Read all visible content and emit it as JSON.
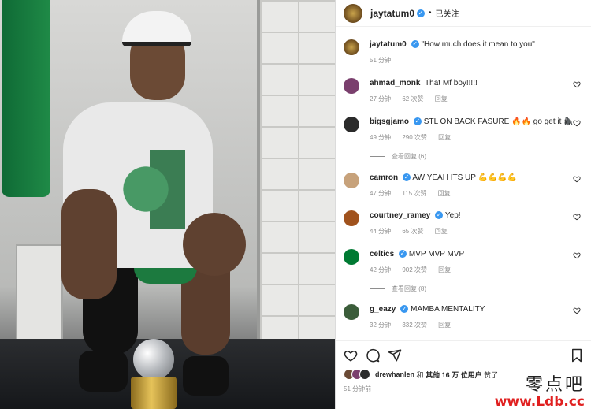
{
  "post": {
    "username": "jaytatum0",
    "follow_status": "已关注",
    "separator": "•",
    "avatar_color": "#8a6a1d"
  },
  "caption": {
    "username": "jaytatum0",
    "text": "\"How much does it mean to you\"",
    "time": "51 分钟"
  },
  "comments": [
    {
      "username": "ahmad_monk",
      "verified": false,
      "text": "That Mf boy!!!!!",
      "time": "27 分钟",
      "likes": "62 次赞",
      "reply": "回复",
      "avatar_color": "#7a3f6d"
    },
    {
      "username": "bigsgjamo",
      "verified": true,
      "text": "STL ON BACK FASURE 🔥🔥 go get it 🦍",
      "time": "49 分钟",
      "likes": "290 次赞",
      "reply": "回复",
      "view_replies": "查看回复 (6)",
      "avatar_color": "#2b2b2b"
    },
    {
      "username": "camron",
      "verified": true,
      "text": "AW YEAH ITS UP 💪💪💪💪",
      "time": "47 分钟",
      "likes": "115 次赞",
      "reply": "回复",
      "avatar_color": "#c7a27b"
    },
    {
      "username": "courtney_ramey",
      "verified": true,
      "text": "Yep!",
      "time": "44 分钟",
      "likes": "65 次赞",
      "reply": "回复",
      "avatar_color": "#a0521d"
    },
    {
      "username": "celtics",
      "verified": true,
      "text": "MVP MVP MVP",
      "time": "42 分钟",
      "likes": "902 次赞",
      "reply": "回复",
      "view_replies": "查看回复 (8)",
      "avatar_color": "#007a33"
    },
    {
      "username": "g_eazy",
      "verified": true,
      "text": "MAMBA MENTALITY",
      "time": "32 分钟",
      "likes": "332 次赞",
      "reply": "回复",
      "avatar_color": "#3b5d3a"
    }
  ],
  "icons": {
    "like": "heart-icon",
    "comment": "comment-icon",
    "share": "share-icon",
    "save": "bookmark-icon",
    "verified": "verified-badge-icon"
  },
  "likes_summary": {
    "user": "drewhanlen",
    "and": "和",
    "others": "其他 16 万 位用户",
    "suffix": "赞了"
  },
  "posted_time": "51 分钟前",
  "watermark": {
    "chinese": "零点吧",
    "url": "www.Ldb.cc"
  },
  "colors": {
    "link_blue": "#3897f0",
    "text_primary": "#262626",
    "text_secondary": "#8e8e8e",
    "watermark_red": "#e02020"
  }
}
